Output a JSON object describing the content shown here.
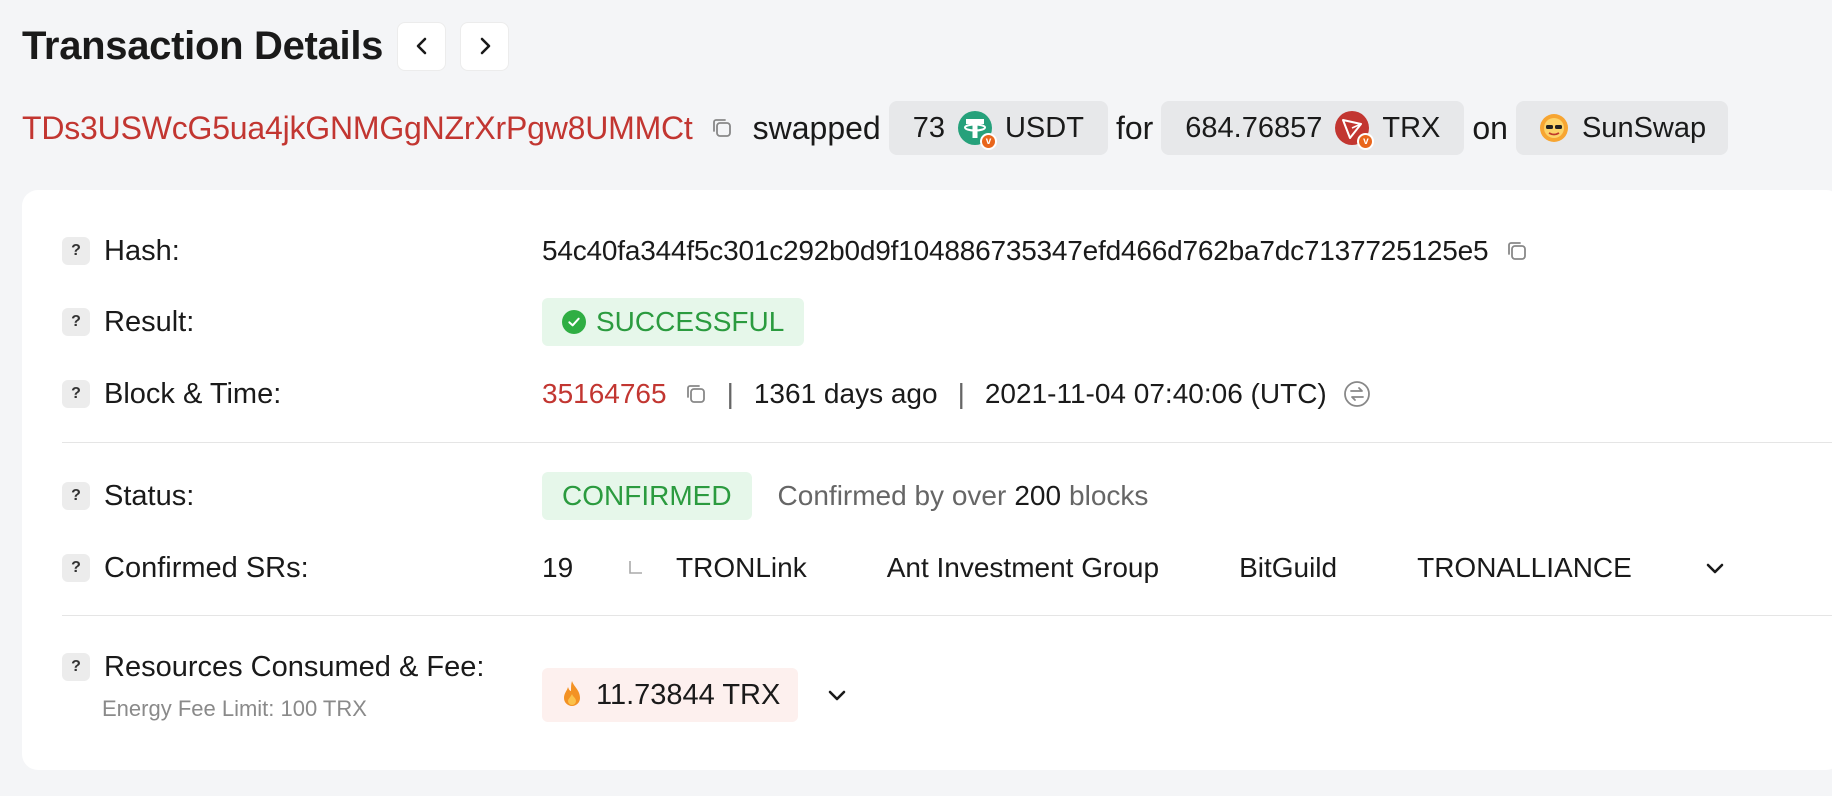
{
  "header": {
    "title": "Transaction Details"
  },
  "summary": {
    "address": "TDs3USWcG5ua4jkGNMGgNZrXrPgw8UMMCt",
    "verb": "swapped",
    "from_amount": "73",
    "from_token": "USDT",
    "word_for": "for",
    "to_amount": "684.76857",
    "to_token": "TRX",
    "word_on": "on",
    "dex": "SunSwap"
  },
  "details": {
    "hash_label": "Hash:",
    "hash_value": "54c40fa344f5c301c292b0d9f104886735347efd466d762ba7dc7137725125e5",
    "result_label": "Result:",
    "result_value": "SUCCESSFUL",
    "block_label": "Block & Time:",
    "block_number": "35164765",
    "sep1": "|",
    "age": "1361 days ago",
    "sep2": "|",
    "timestamp": "2021-11-04 07:40:06 (UTC)",
    "status_label": "Status:",
    "status_value": "CONFIRMED",
    "confirmed_prefix": "Confirmed by over",
    "confirmed_count": "200",
    "confirmed_suffix": "blocks",
    "srs_label": "Confirmed SRs:",
    "srs_count": "19",
    "srs": [
      "TRONLink",
      "Ant Investment Group",
      "BitGuild",
      "TRONALLIANCE"
    ],
    "fee_label": "Resources Consumed & Fee:",
    "fee_value": "11.73844 TRX",
    "energy_limit": "Energy Fee Limit: 100 TRX"
  },
  "colors": {
    "accent_red": "#c23631",
    "success_green": "#2b9b3f",
    "success_bg": "#e6f7ea",
    "fee_bg": "#fdf0ee"
  }
}
